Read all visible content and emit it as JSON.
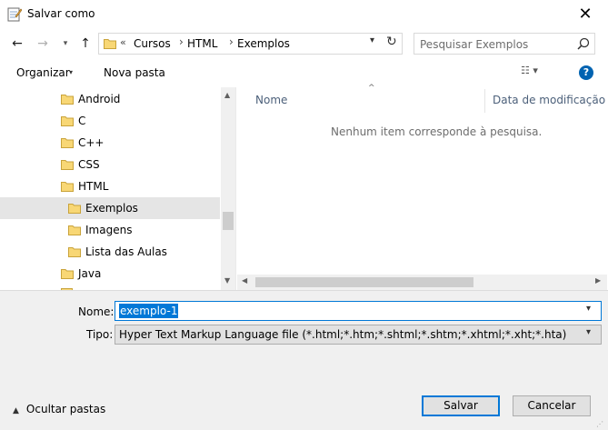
{
  "window": {
    "title": "Salvar como",
    "close_glyph": "✕"
  },
  "nav": {
    "back_glyph": "←",
    "forward_glyph": "→",
    "recent_glyph": "▾",
    "up_glyph": "↑",
    "breadcrumb_prefix": "«",
    "breadcrumb": [
      "Cursos",
      "HTML",
      "Exemplos"
    ],
    "breadcrumb_sep": "›",
    "address_dropdown_glyph": "▾",
    "refresh_glyph": "↻"
  },
  "search": {
    "placeholder": "Pesquisar Exemplos"
  },
  "toolbar": {
    "organize_label": "Organizar",
    "organize_arrow": "▾",
    "new_folder_label": "Nova pasta",
    "view_glyph": "☷ ▾",
    "help_glyph": "?"
  },
  "tree": {
    "items": [
      {
        "label": "Android",
        "indent": 1,
        "selected": false
      },
      {
        "label": "C",
        "indent": 1,
        "selected": false
      },
      {
        "label": "C++",
        "indent": 1,
        "selected": false
      },
      {
        "label": "CSS",
        "indent": 1,
        "selected": false
      },
      {
        "label": "HTML",
        "indent": 1,
        "selected": false
      },
      {
        "label": "Exemplos",
        "indent": 2,
        "selected": true
      },
      {
        "label": "Imagens",
        "indent": 2,
        "selected": false
      },
      {
        "label": "Lista das Aulas",
        "indent": 2,
        "selected": false
      },
      {
        "label": "Java",
        "indent": 1,
        "selected": false
      }
    ],
    "scroll_up_glyph": "▲",
    "scroll_down_glyph": "▼"
  },
  "filelist": {
    "sort_glyph": "^",
    "columns": [
      "Nome",
      "Data de modificação"
    ],
    "empty_message": "Nenhum item corresponde à pesquisa.",
    "scroll_left_glyph": "◀",
    "scroll_right_glyph": "▶"
  },
  "form": {
    "name_label": "Nome:",
    "name_value": "exemplo-1",
    "type_label": "Tipo:",
    "type_value": "Hyper Text Markup Language file (*.html;*.htm;*.shtml;*.shtm;*.xhtml;*.xht;*.hta)",
    "dropdown_glyph": "▾"
  },
  "footer": {
    "hide_folders_arrow": "▲",
    "hide_folders_label": "Ocultar pastas",
    "save_label": "Salvar",
    "cancel_label": "Cancelar",
    "grip_glyph": "⋰"
  },
  "colors": {
    "accent": "#0078d7",
    "selection_bg": "#e5e5e5",
    "folder": "#f8d775",
    "help": "#0063b1"
  }
}
